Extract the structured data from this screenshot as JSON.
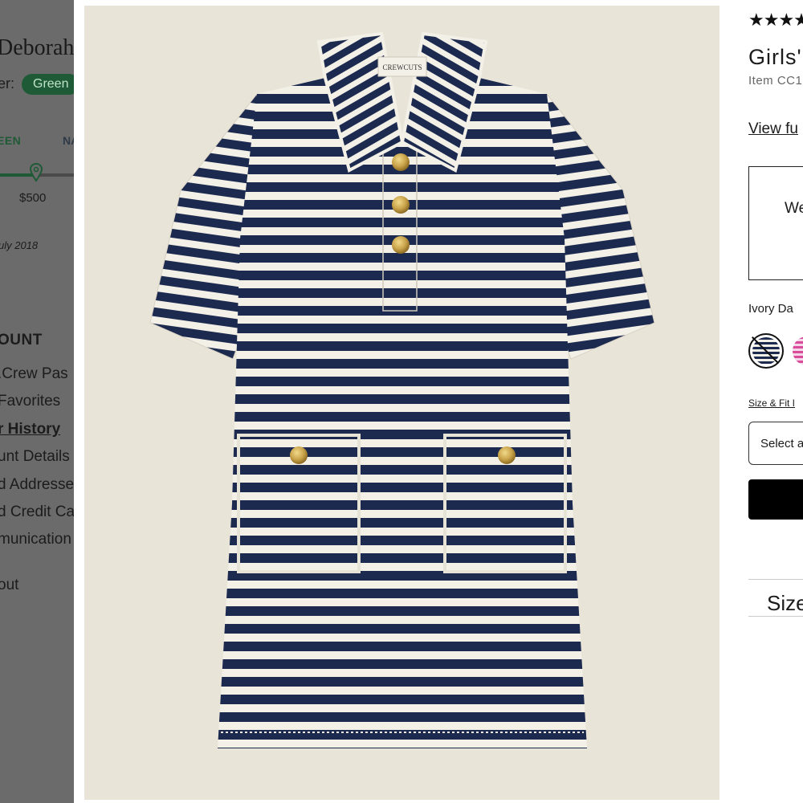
{
  "account_panel": {
    "user_name": "Deborah",
    "tier_label": "er:",
    "tier_badge": "Green",
    "tier_current": "EEN",
    "tier_next": "NA",
    "progress_amount": "$500",
    "member_since": "uly 2018",
    "section_heading": "OUNT",
    "nav_items": [
      {
        "label": ".Crew Pas",
        "active": false
      },
      {
        "label": "Favorites",
        "active": false
      },
      {
        "label": "r History",
        "active": true
      },
      {
        "label": "unt Details",
        "active": false
      },
      {
        "label": "d Addresse",
        "active": false
      },
      {
        "label": "d Credit Ca",
        "active": false
      },
      {
        "label": "munication",
        "active": false
      },
      {
        "label": "out",
        "active": false
      }
    ]
  },
  "product_image": {
    "brand_label": "CREWCUTS",
    "colors": {
      "navy": "#1c2a4f",
      "ivory": "#f3f0e7",
      "gold": "#c9a34a",
      "backdrop": "#e9e4d8"
    }
  },
  "details_panel": {
    "rating_stars": "★★★★",
    "title": "Girls'",
    "item_number": "Item CC1",
    "view_full_details": "View fu",
    "promo_text": "We",
    "color_label": "Ivory Da",
    "size_fit_link": "Size & Fit I",
    "size_select_placeholder": "Select a",
    "size_heading": "Size"
  },
  "icons": {
    "favorite": "heart-outline-icon",
    "progress_marker": "location-pin-icon"
  }
}
